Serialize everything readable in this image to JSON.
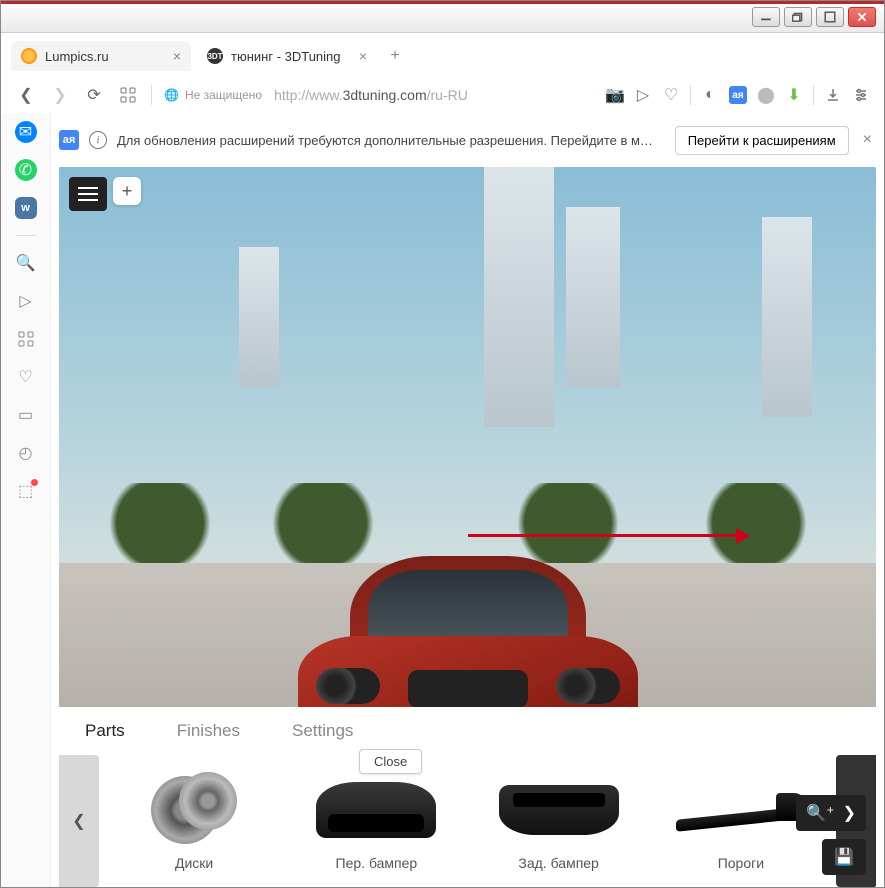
{
  "window": {
    "controls": [
      "min",
      "max",
      "close"
    ]
  },
  "tabs": [
    {
      "title": "Lumpics.ru",
      "active": false
    },
    {
      "title": "тюнинг - 3DTuning",
      "active": true
    }
  ],
  "address": {
    "insecure_label": "Не защищено",
    "url_dim_prefix": "http://www.",
    "url_host": "3dtuning.com",
    "url_path": "/ru-RU"
  },
  "notification": {
    "text": "Для обновления расширений требуются дополнительные разрешения. Перейдите в м…",
    "button": "Перейти к расширениям"
  },
  "bottom_tabs": {
    "parts": "Parts",
    "finishes": "Finishes",
    "settings": "Settings"
  },
  "close_label": "Close",
  "parts": {
    "wheels": "Диски",
    "front_bumper": "Пер. бампер",
    "rear_bumper": "Зад. бампер",
    "skirts": "Пороги"
  }
}
